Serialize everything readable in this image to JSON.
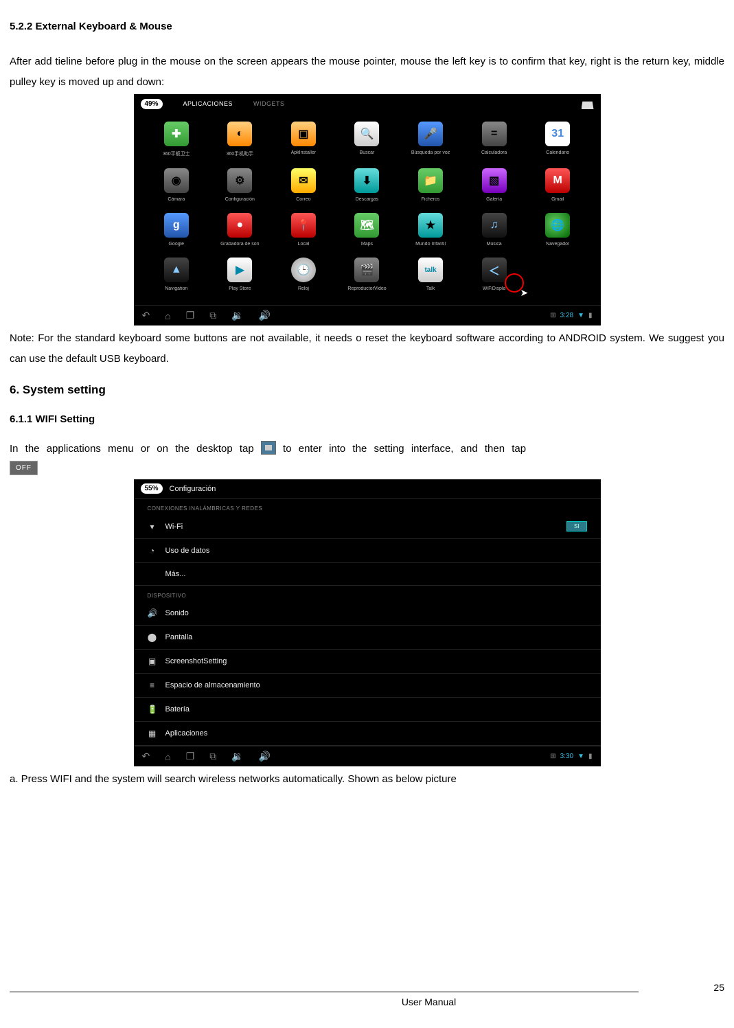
{
  "section_522_title": "5.2.2 External Keyboard & Mouse",
  "para_522": "After add tieline before plug in the mouse on the screen appears the mouse pointer, mouse the left key is to confirm that key, right is the return key, middle pulley key is moved up and down:",
  "note_text": "Note: For the standard keyboard some buttons are not available, it needs o reset the keyboard software according to ANDROID system. We suggest you can use the default USB keyboard.",
  "section_6_title": "6. System setting",
  "section_611_title": "6.1.1 WIFI Setting",
  "para_611_pre": "In  the  applications  menu  or  on  the  desktop  tap ",
  "para_611_post": "  to  enter  into  the  setting  interface,  and  then  tap",
  "off_label": "OFF",
  "para_a": "a. Press WIFI and the system will search wireless networks automatically. Shown as below picture",
  "footer_center": "User Manual",
  "footer_page": "25",
  "apps_shot": {
    "battery": "49%",
    "tab_apps": "APLICACIONES",
    "tab_widgets": "WIDGETS",
    "time": "3:28",
    "grid": [
      {
        "label": "360平板卫士",
        "cls": "ic-green",
        "glyph": "✚"
      },
      {
        "label": "360手机助手",
        "cls": "ic-orange",
        "glyph": "◐"
      },
      {
        "label": "ApkInstaller",
        "cls": "ic-orange",
        "glyph": "▣"
      },
      {
        "label": "Buscar",
        "cls": "ic-white",
        "glyph": "🔍"
      },
      {
        "label": "Búsqueda por voz",
        "cls": "ic-blue",
        "glyph": "🎤"
      },
      {
        "label": "Calculadora",
        "cls": "ic-gray",
        "glyph": "="
      },
      {
        "label": "Calendario",
        "cls": "ic-gcal",
        "glyph": "31"
      },
      {
        "label": "Cámara",
        "cls": "ic-gray",
        "glyph": "◉"
      },
      {
        "label": "Configuración",
        "cls": "ic-gray",
        "glyph": "⚙"
      },
      {
        "label": "Correo",
        "cls": "ic-yellow",
        "glyph": "✉"
      },
      {
        "label": "Descargas",
        "cls": "ic-teal",
        "glyph": "⬇"
      },
      {
        "label": "Ficheros",
        "cls": "ic-green",
        "glyph": "📁"
      },
      {
        "label": "Galería",
        "cls": "ic-purple",
        "glyph": "▧"
      },
      {
        "label": "Gmail",
        "cls": "ic-red",
        "glyph": "M"
      },
      {
        "label": "Google",
        "cls": "ic-blue",
        "glyph": "g"
      },
      {
        "label": "Grabadora de son",
        "cls": "ic-red",
        "glyph": "●"
      },
      {
        "label": "Local",
        "cls": "ic-red",
        "glyph": "📍"
      },
      {
        "label": "Maps",
        "cls": "ic-green",
        "glyph": "🗺"
      },
      {
        "label": "Mundo Infantil",
        "cls": "ic-teal",
        "glyph": "★"
      },
      {
        "label": "Música",
        "cls": "ic-dark",
        "glyph": "♫"
      },
      {
        "label": "Navegador",
        "cls": "ic-globe",
        "glyph": "🌐"
      },
      {
        "label": "Navigation",
        "cls": "ic-dark",
        "glyph": "▲"
      },
      {
        "label": "Play Store",
        "cls": "ic-white",
        "glyph": "▶"
      },
      {
        "label": "Reloj",
        "cls": "ic-clock",
        "glyph": "🕒"
      },
      {
        "label": "ReproductorVideo",
        "cls": "ic-gray",
        "glyph": "🎬"
      },
      {
        "label": "Talk",
        "cls": "ic-white",
        "glyph": "talk"
      },
      {
        "label": "WiFiDispla",
        "cls": "ic-dark",
        "glyph": "＜"
      }
    ]
  },
  "settings_shot": {
    "battery": "55%",
    "title": "Configuración",
    "group_wireless": "CONEXIONES INALÁMBRICAS Y REDES",
    "group_device": "DISPOSITIVO",
    "rows_wireless": [
      {
        "icon": "▾",
        "label": "Wi-Fi",
        "toggle": "SI"
      },
      {
        "icon": "◔",
        "label": "Uso de datos"
      },
      {
        "icon": "",
        "label": "Más..."
      }
    ],
    "rows_device": [
      {
        "icon": "🔊",
        "label": "Sonido"
      },
      {
        "icon": "⬤",
        "label": "Pantalla"
      },
      {
        "icon": "▣",
        "label": "ScreenshotSetting"
      },
      {
        "icon": "≡",
        "label": "Espacio de almacenamiento"
      },
      {
        "icon": "🔋",
        "label": "Batería"
      },
      {
        "icon": "▦",
        "label": "Aplicaciones"
      }
    ],
    "time": "3:30"
  }
}
